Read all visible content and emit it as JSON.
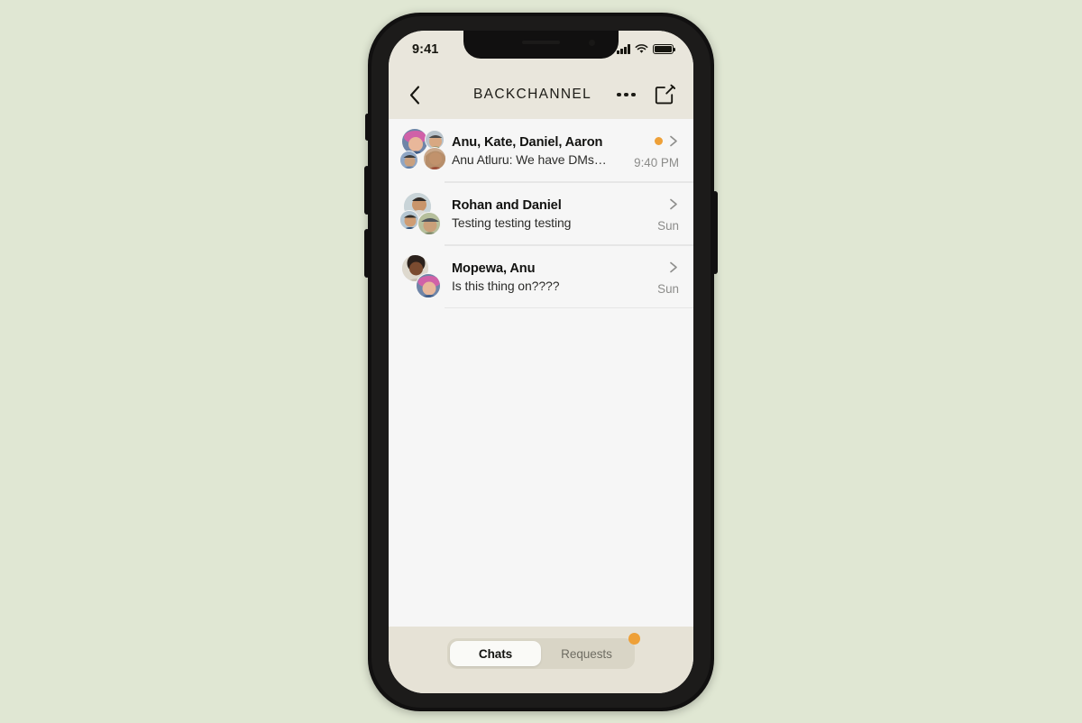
{
  "background_color": "#e0e7d3",
  "device": {
    "frame_color": "#111010",
    "side_buttons": [
      "mute-switch",
      "volume-up",
      "volume-down",
      "power"
    ]
  },
  "status_bar": {
    "time": "9:41",
    "icons": [
      "cellular-signal-icon",
      "wifi-icon",
      "battery-icon"
    ]
  },
  "nav_bar": {
    "back_icon": "chevron-left-icon",
    "title": "BACKCHANNEL",
    "more_icon": "ellipsis-icon",
    "compose_icon": "compose-pencil-square-icon"
  },
  "accent_color": "#eea038",
  "chats": [
    {
      "title": "Anu, Kate, Daniel, Aaron",
      "preview": "Anu Atluru: We have DMs…",
      "time": "9:40 PM",
      "unread": true,
      "avatar_count": 4
    },
    {
      "title": "Rohan and Daniel",
      "preview": "Testing testing testing",
      "time": "Sun",
      "unread": false,
      "avatar_count": 3
    },
    {
      "title": "Mopewa, Anu",
      "preview": "Is this thing on????",
      "time": "Sun",
      "unread": false,
      "avatar_count": 2
    }
  ],
  "tab_bar": {
    "tabs": [
      {
        "label": "Chats",
        "active": true,
        "badge": false
      },
      {
        "label": "Requests",
        "active": false,
        "badge": true
      }
    ]
  }
}
